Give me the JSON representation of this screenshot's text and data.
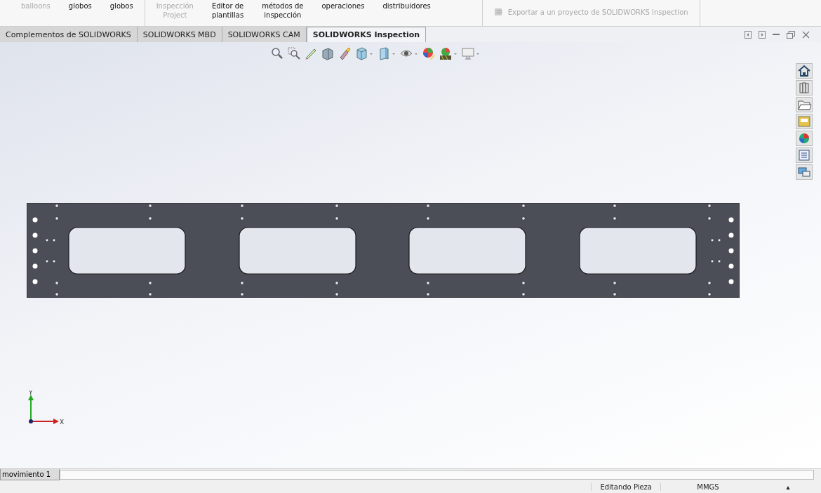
{
  "ribbon": {
    "groups": [
      {
        "items": [
          {
            "lines": [
              "balloons"
            ],
            "disabled": true
          },
          {
            "lines": [
              "globos"
            ],
            "disabled": false
          },
          {
            "lines": [
              "globos"
            ],
            "disabled": false
          }
        ]
      },
      {
        "items": [
          {
            "lines": [
              "Inspección",
              "Project"
            ],
            "disabled": true
          },
          {
            "lines": [
              "Editor de",
              "plantillas"
            ],
            "disabled": false
          },
          {
            "lines": [
              "métodos de",
              "inspección"
            ],
            "disabled": false
          },
          {
            "lines": [
              "operaciones"
            ],
            "disabled": false
          },
          {
            "lines": [
              "distribuidores"
            ],
            "disabled": false
          }
        ]
      },
      {
        "items": [
          {
            "lines": [
              "Exportar a un proyecto de SOLIDWORKS Inspection"
            ],
            "disabled": true,
            "kind": "export"
          }
        ]
      }
    ]
  },
  "tabs": [
    {
      "label": "Complementos de SOLIDWORKS",
      "selected": false
    },
    {
      "label": "SOLIDWORKS MBD",
      "selected": false
    },
    {
      "label": "SOLIDWORKS CAM",
      "selected": false
    },
    {
      "label": "SOLIDWORKS Inspection",
      "selected": true
    }
  ],
  "triad": {
    "y_label": "Y",
    "x_label": "X"
  },
  "bottom_tabs": [
    {
      "label": "movimiento 1"
    }
  ],
  "status_bar": {
    "fields": [
      "Editando Pieza",
      "MMGS",
      "▴"
    ]
  }
}
